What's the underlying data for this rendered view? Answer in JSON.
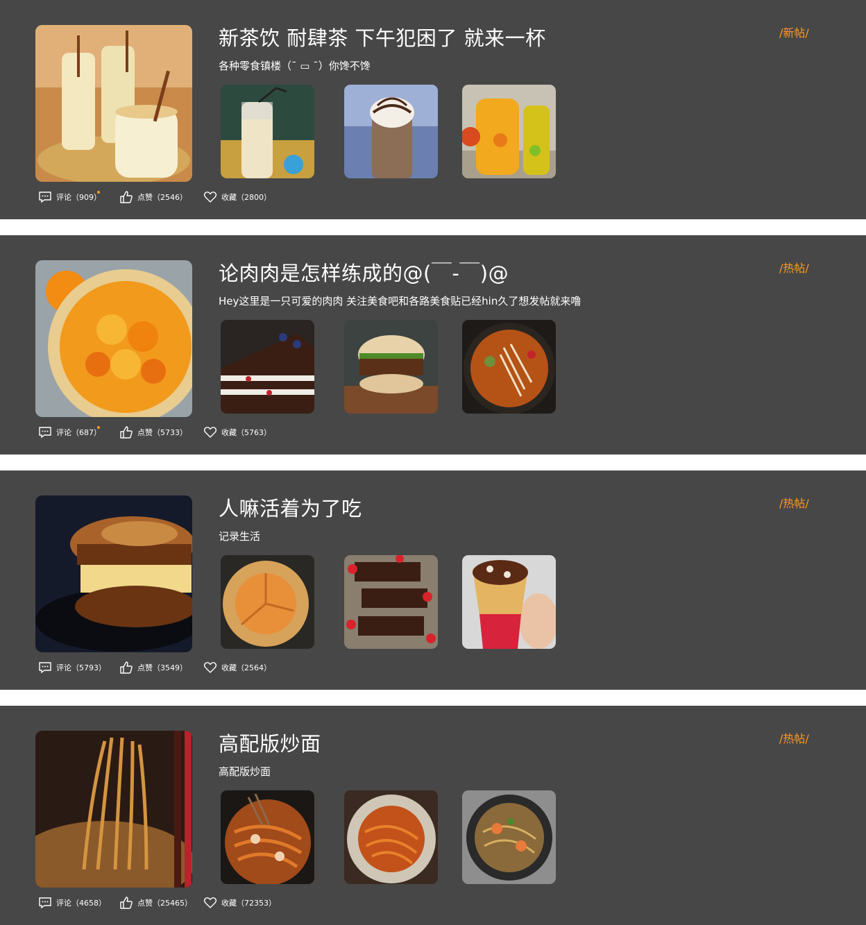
{
  "colors": {
    "panel": "#474747",
    "tag": "#ff9a1f",
    "text": "#ffffff"
  },
  "stat_labels": {
    "comment": "评论",
    "like": "点赞",
    "favorite": "收藏"
  },
  "posts": [
    {
      "title": "新茶饮 耐肆茶 下午犯困了 就来一杯",
      "desc": "各种零食镇楼（¯ ▭ ¯）你馋不馋",
      "tag": "/新帖/",
      "comments": "（909）",
      "likes": "（2546）",
      "favorites": "（2800）",
      "comment_dot": true,
      "cover": "milkshake-glasses-photo",
      "thumbs": [
        "milk-bottle-drink-photo",
        "chocolate-frappe-photo",
        "citrus-juice-pitchers-photo"
      ]
    },
    {
      "title": "论肉肉是怎样练成的@(￣-￣)@",
      "desc": "Hey这里是一只可爱的肉肉 关注美食吧和各路美食贴已经hin久了想发帖就来噜",
      "tag": "/热帖/",
      "comments": "（687）",
      "likes": "（5733）",
      "favorites": "（5763）",
      "comment_dot": true,
      "cover": "orange-tart-photo",
      "thumbs": [
        "black-forest-cake-photo",
        "burger-photo",
        "noodle-hotpot-photo"
      ]
    },
    {
      "title": "人嘛活着为了吃",
      "desc": "记录生活",
      "tag": "/热帖/",
      "comments": "（5793）",
      "likes": "（3549）",
      "favorites": "（2564）",
      "comment_dot": false,
      "cover": "french-toast-sandwich-photo",
      "thumbs": [
        "galette-pie-photo",
        "brownies-strawberries-photo",
        "crepe-cone-photo"
      ]
    },
    {
      "title": "高配版炒面",
      "desc": "高配版炒面",
      "tag": "/热帖/",
      "comments": "（4658）",
      "likes": "（25465）",
      "favorites": "（72353）",
      "comment_dot": false,
      "cover": "stir-fried-noodles-photo",
      "thumbs": [
        "seafood-noodles-photo",
        "spaghetti-plate-photo",
        "shrimp-pasta-photo"
      ]
    }
  ]
}
